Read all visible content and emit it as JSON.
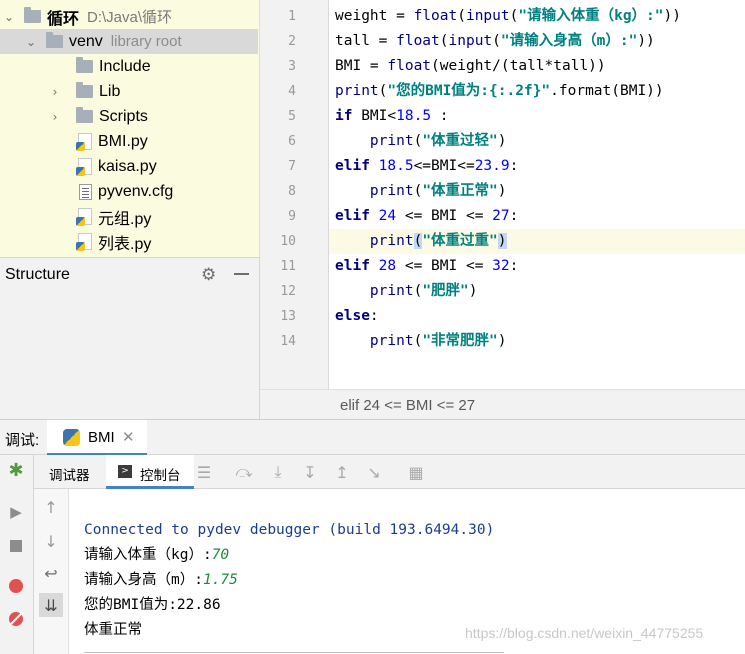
{
  "project": {
    "root_name": "循环",
    "root_path": "D:\\Java\\循环",
    "venv_name": "venv",
    "venv_sub": "library root",
    "children": [
      "Include",
      "Lib",
      "Scripts",
      "BMI.py",
      "kaisa.py",
      "pyvenv.cfg",
      "元组.py",
      "列表.py"
    ]
  },
  "structure": {
    "title": "Structure"
  },
  "editor": {
    "line_numbers": [
      "1",
      "2",
      "3",
      "4",
      "5",
      "6",
      "7",
      "8",
      "9",
      "10",
      "11",
      "12",
      "13",
      "14"
    ],
    "current_line": 10,
    "breadcrumb": "elif 24 <= BMI <= 27"
  },
  "debug": {
    "label": "调试:",
    "tab_name": "BMI",
    "tabs": {
      "debugger": "调试器",
      "console": "控制台"
    }
  },
  "console": {
    "connected": "Connected to pydev debugger (build 193.6494.30)",
    "prompt_weight": "请输入体重（kg）:",
    "input_weight": "70",
    "prompt_height": "请输入身高（m）:",
    "input_height": "1.75",
    "bmi_line": "您的BMI值为:22.86",
    "result": "体重正常",
    "watermark": "https://blog.csdn.net/weixin_44775255"
  },
  "colors": {
    "keyword": "#000080",
    "string": "#008080",
    "number": "#0000ff",
    "accent": "#4083c9",
    "current_line": "#fcfae4",
    "tree_bg": "#fbfbe0"
  }
}
